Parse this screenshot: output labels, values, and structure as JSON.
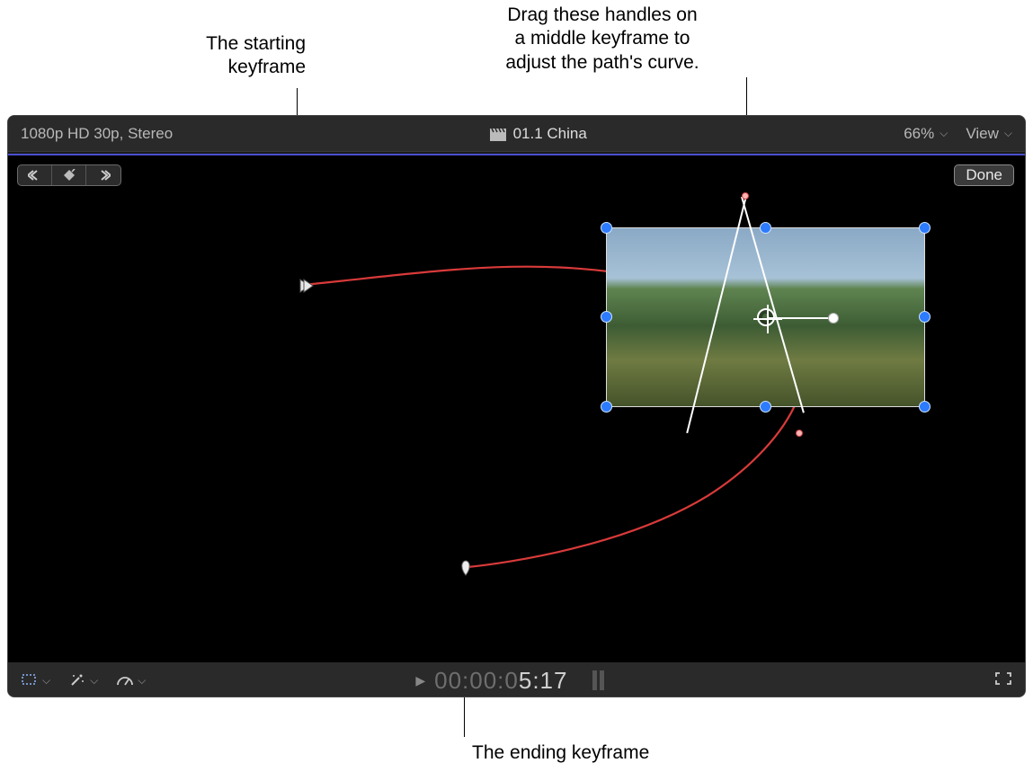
{
  "callouts": {
    "start": "The starting\nkeyframe",
    "curve": "Drag these handles on\na middle keyframe to\nadjust the path's curve.",
    "end": "The ending keyframe"
  },
  "titlebar": {
    "format": "1080p HD 30p, Stereo",
    "clip_name": "01.1 China",
    "zoom": "66%",
    "view_label": "View"
  },
  "buttons": {
    "done": "Done"
  },
  "footer": {
    "timecode_dim": "00:00:0",
    "timecode_bright": "5:17"
  },
  "icons": {
    "clapper": "clapperboard-icon",
    "prev_kf": "prev-keyframe-icon",
    "add_kf": "add-keyframe-icon",
    "next_kf": "next-keyframe-icon",
    "crop_tool": "crop-tool-icon",
    "enhance_tool": "enhance-tool-icon",
    "retime_tool": "retime-tool-icon",
    "fullscreen": "fullscreen-icon",
    "play": "play-icon"
  },
  "colors": {
    "accent": "#4a4fcf",
    "handle_blue": "#2d7bff",
    "path_red": "#d93a3a"
  }
}
